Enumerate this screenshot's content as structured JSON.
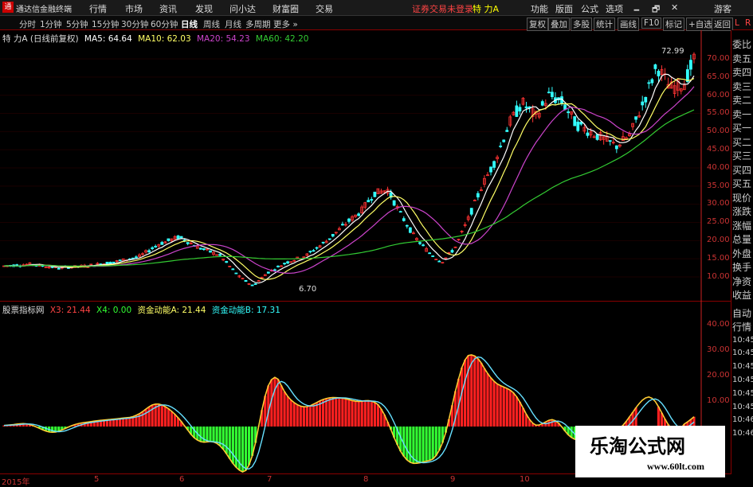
{
  "app": {
    "title": "通达信金融终端",
    "logo_glyph": "通"
  },
  "menu": [
    "行情",
    "市场",
    "资讯",
    "发现",
    "问小达",
    "财富圈",
    "交易"
  ],
  "notice": "证券交易未登录",
  "stock_name": "特 力A",
  "right_menu": [
    "功能",
    "版面",
    "公式",
    "选项"
  ],
  "window_controls": [
    "🗕",
    "🗗",
    "✕"
  ],
  "guest": "游客",
  "periods": [
    "分时",
    "1分钟",
    "5分钟",
    "15分钟",
    "30分钟",
    "60分钟",
    "日线",
    "周线",
    "月线",
    "多周期",
    "更多 »"
  ],
  "active_period": "日线",
  "tools": [
    "复权",
    "叠加",
    "多股",
    "统计",
    "画线",
    "F10",
    "标记",
    "+自选",
    "返回"
  ],
  "main_legend": {
    "title": "特 力A (日线前复权)",
    "ma5": "MA5: 64.64",
    "ma10": "MA10: 62.03",
    "ma20": "MA20: 54.23",
    "ma60": "MA60: 42.20"
  },
  "main_yaxis": [
    "70.00",
    "65.00",
    "60.00",
    "55.00",
    "50.00",
    "45.00",
    "40.00",
    "35.00",
    "30.00",
    "25.00",
    "20.00",
    "15.00",
    "10.00"
  ],
  "high_label": "72.99",
  "low_label": "6.70",
  "sub_legend": {
    "name": "股票指标网",
    "x3": "X3: 21.44",
    "x4": "X4: 0.00",
    "a": "资金动能A: 21.44",
    "b": "资金动能B: 17.31"
  },
  "sub_yaxis": [
    "40.00",
    "30.00",
    "20.00",
    "10.00"
  ],
  "right_tabs": [
    "委比",
    "卖五",
    "卖四",
    "卖三",
    "卖二",
    "卖一",
    "买一",
    "买二",
    "买三",
    "买四",
    "买五",
    "现价",
    "涨跌",
    "涨幅",
    "总量",
    "外盘",
    "换手",
    "净资",
    "收益"
  ],
  "right_tabs2": [
    "自动",
    "行情",
    "10:45",
    "10:45",
    "10:45",
    "10:45",
    "10:45",
    "10:45",
    "10:46",
    "10:46"
  ],
  "top_corner": {
    "l": "L",
    "r": "R"
  },
  "xaxis": [
    "2015年",
    "5",
    "6",
    "7",
    "8",
    "9",
    "10"
  ],
  "watermark": {
    "title": "乐淘公式网",
    "url": "www.60lt.com"
  },
  "colors": {
    "up": "#ff3333",
    "down": "#33ffff",
    "ma5": "#ffffff",
    "ma10": "#ffff66",
    "ma20": "#cc44cc",
    "ma60": "#33cc33",
    "bar_up": "#ff2020",
    "bar_down": "#33ff33",
    "axis": "#cc2222"
  }
}
